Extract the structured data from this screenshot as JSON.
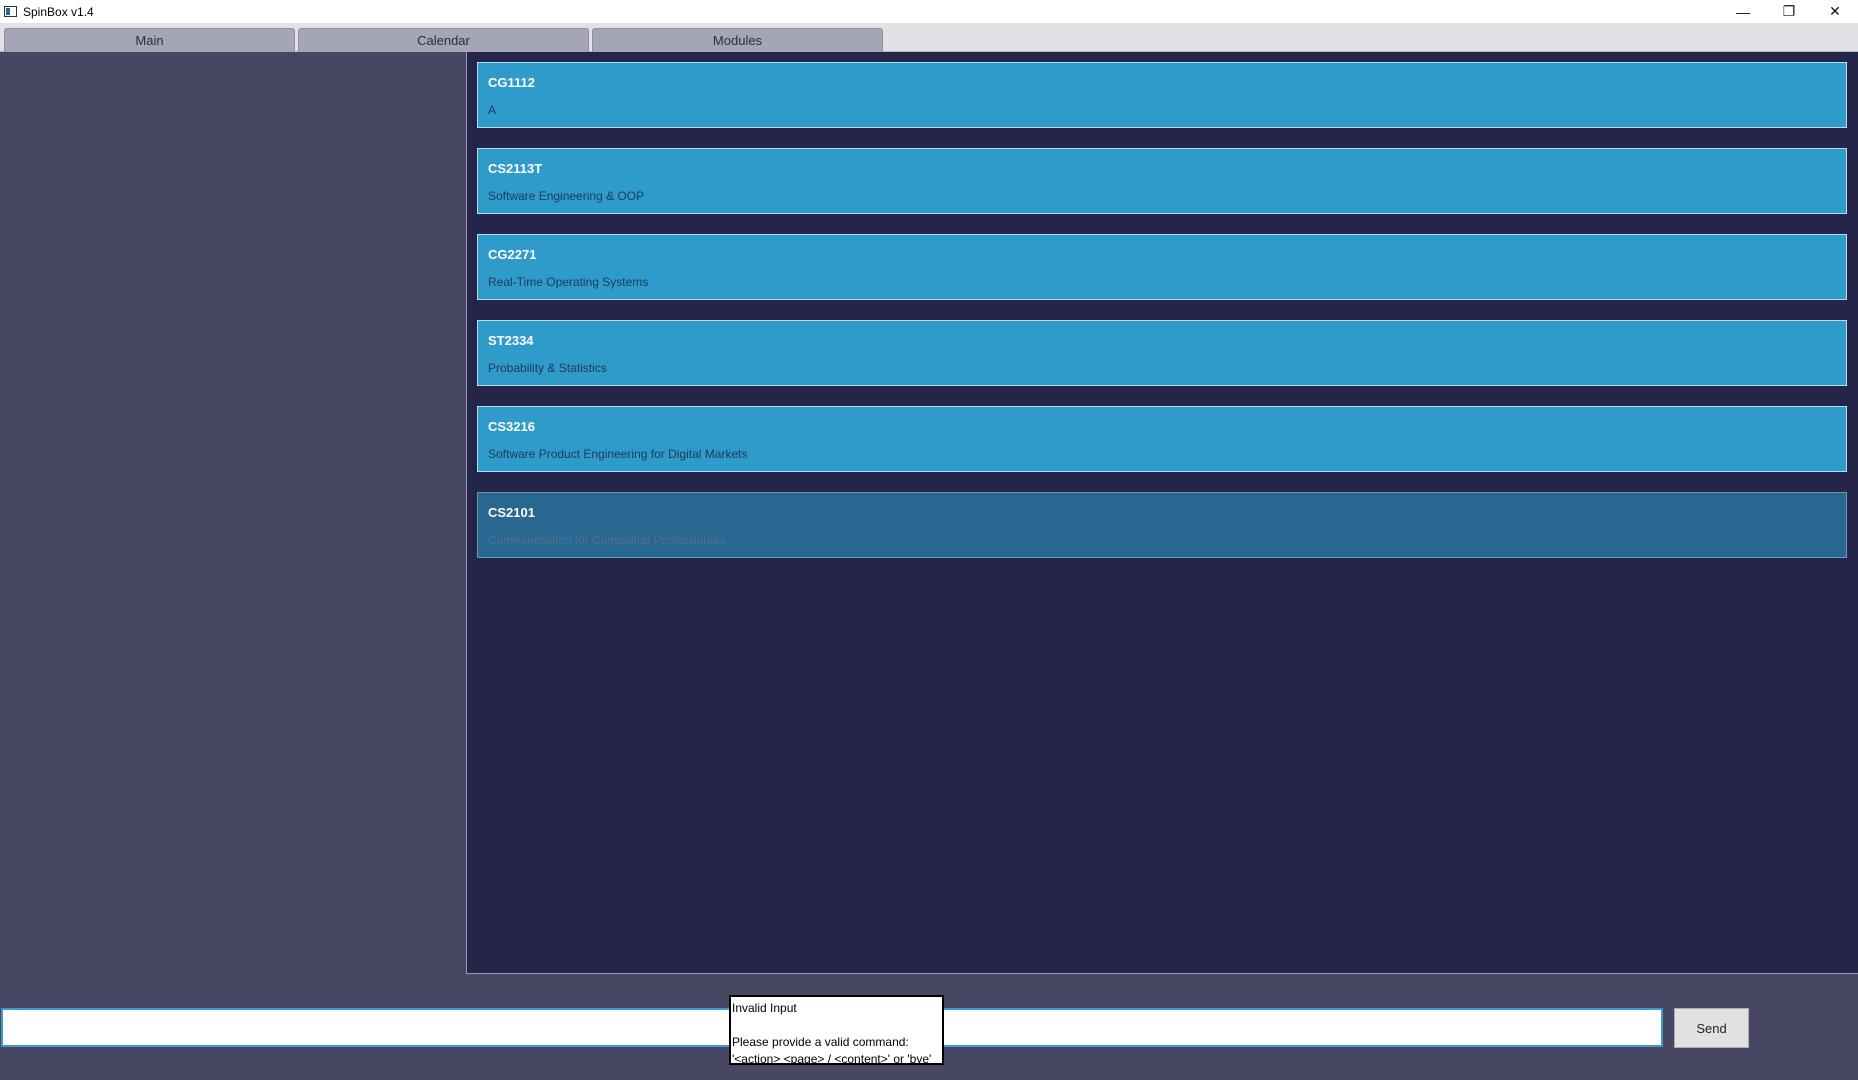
{
  "window": {
    "title": "SpinBox v1.4",
    "minimize_glyph": "—",
    "restore_glyph": "❐",
    "close_glyph": "✕"
  },
  "tabs": [
    {
      "label": "Main"
    },
    {
      "label": "Calendar"
    },
    {
      "label": "Modules"
    }
  ],
  "modules": [
    {
      "code": "CG1112",
      "name": "A"
    },
    {
      "code": "CS2113T",
      "name": "Software Engineering & OOP"
    },
    {
      "code": "CG2271",
      "name": "Real-Time Operating Systems"
    },
    {
      "code": "ST2334",
      "name": "Probability & Statistics"
    },
    {
      "code": "CS3216",
      "name": "Software Product Engineering for Digital Markets"
    },
    {
      "code": "CS2101",
      "name": "Communication for Computing Professionals"
    }
  ],
  "command": {
    "value": "",
    "send_label": "Send"
  },
  "tooltip": {
    "title": "Invalid Input",
    "line1": "Please provide a valid command:",
    "line2": "'<action> <page> / <content>' or 'bye'"
  },
  "colors": {
    "module_card": "#2e9bcb",
    "module_card_selected": "#286790",
    "content_bg": "#25254a",
    "sidebar_bg": "#474764",
    "input_border": "#3a9cd3"
  }
}
